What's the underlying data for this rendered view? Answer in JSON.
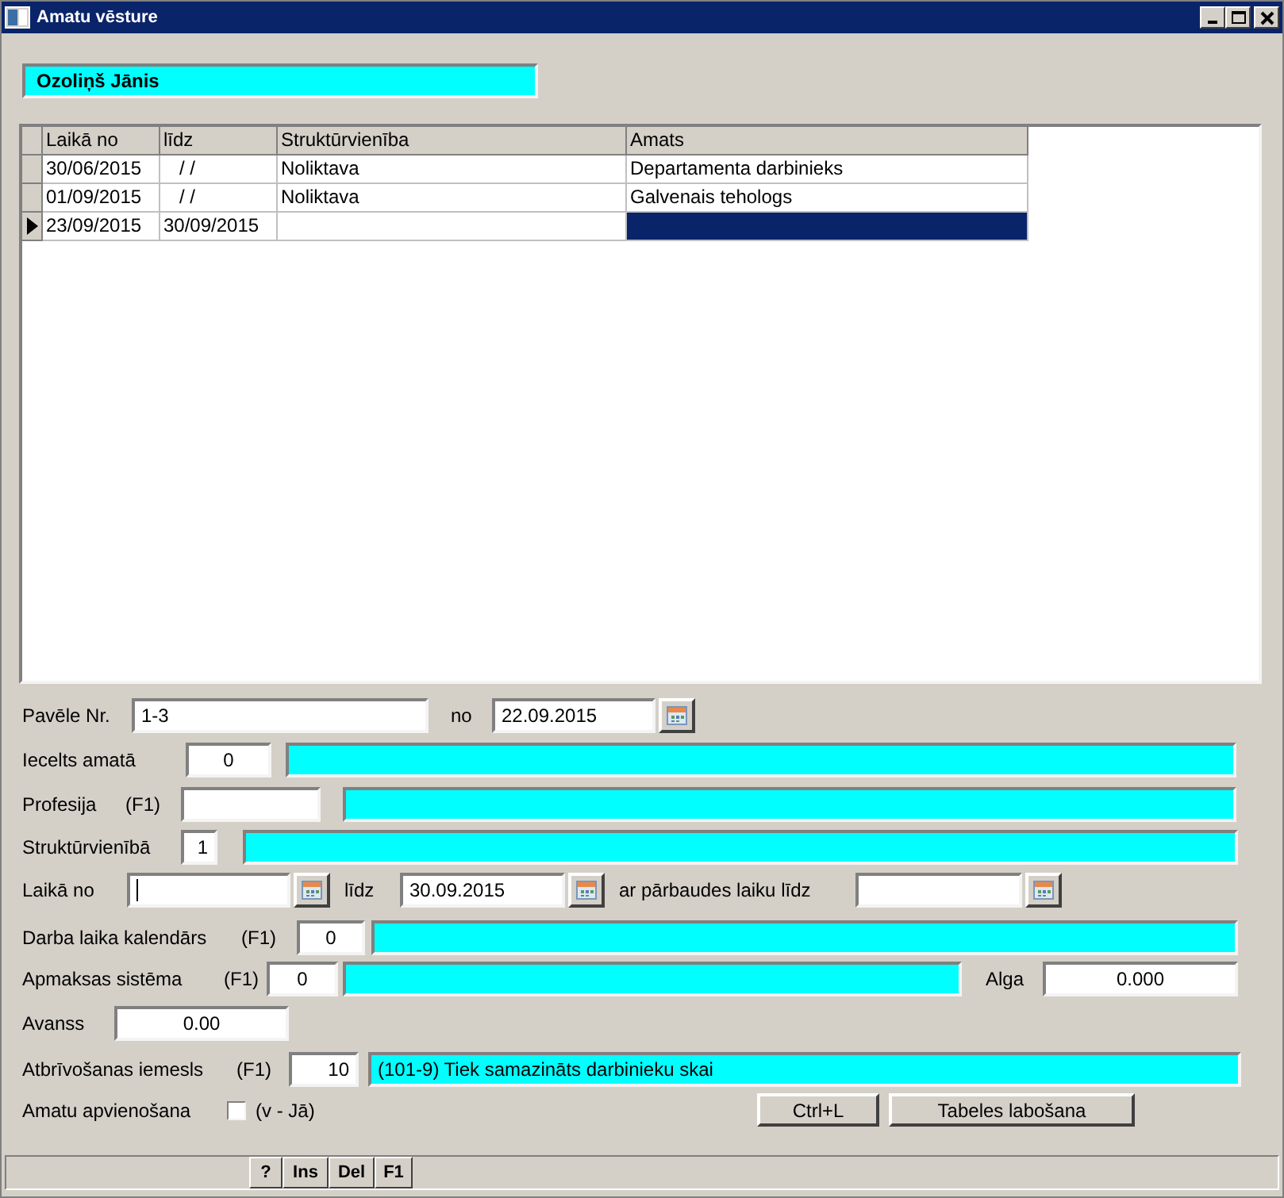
{
  "window": {
    "title": "Amatu vēsture"
  },
  "employee_name": "Ozoliņš Jānis",
  "history_table": {
    "columns": [
      "Laikā no",
      "līdz",
      "Struktūrvienība",
      "Amats"
    ],
    "rows": [
      {
        "from": "30/06/2015",
        "to": "/ /",
        "unit": "Noliktava",
        "position": "Departamenta darbinieks",
        "selected": false
      },
      {
        "from": "01/09/2015",
        "to": "/ /",
        "unit": "Noliktava",
        "position": "Galvenais tehologs",
        "selected": false
      },
      {
        "from": "23/09/2015",
        "to": "30/09/2015",
        "selected": true
      }
    ]
  },
  "form": {
    "order": {
      "label": "Pavēle Nr.",
      "value": "1-3",
      "date_label": "no",
      "date": "22.09.2015"
    },
    "appointed": {
      "label": "Iecelts amatā",
      "code": "0"
    },
    "profession": {
      "label": "Profesija",
      "hint": "(F1)"
    },
    "unit": {
      "label": "Struktūrvienībā",
      "code": "1"
    },
    "period": {
      "label": "Laikā no",
      "from_focused": true,
      "to_label": "līdz",
      "to": "30.09.2015",
      "probation_label": "ar pārbaudes laiku līdz"
    },
    "calendar": {
      "label": "Darba laika kalendārs",
      "hint": "(F1)",
      "code": "0"
    },
    "pay_system": {
      "label": "Apmaksas sistēma",
      "hint": "(F1)",
      "code": "0",
      "salary_label": "Alga",
      "salary": "0.000"
    },
    "advance": {
      "label": "Avanss",
      "value": "0.00"
    },
    "dismissal": {
      "label": "Atbrīvošanas iemesls",
      "hint": "(F1)",
      "code": "10",
      "description": "(101-9) Tiek samazināts darbinieku skai"
    },
    "combined": {
      "label": "Amatu apvienošana",
      "checked": false,
      "hint": "(v - Jā)"
    }
  },
  "buttons": [
    "Ctrl+L",
    "Tabeles labošana"
  ],
  "status_bar": {
    "keys": [
      "?",
      "Ins",
      "Del",
      "F1"
    ]
  }
}
